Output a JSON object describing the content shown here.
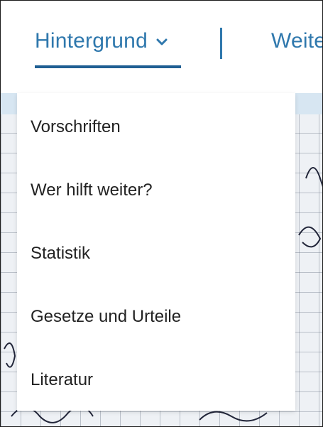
{
  "nav": {
    "active_tab_label": "Hintergrund",
    "next_tab_label": "Weite",
    "accent_color": "#2f78ad"
  },
  "dropdown": {
    "items": [
      {
        "label": "Vorschriften"
      },
      {
        "label": "Wer hilft weiter?"
      },
      {
        "label": "Statistik"
      },
      {
        "label": "Gesetze und Urteile"
      },
      {
        "label": "Literatur"
      }
    ]
  }
}
